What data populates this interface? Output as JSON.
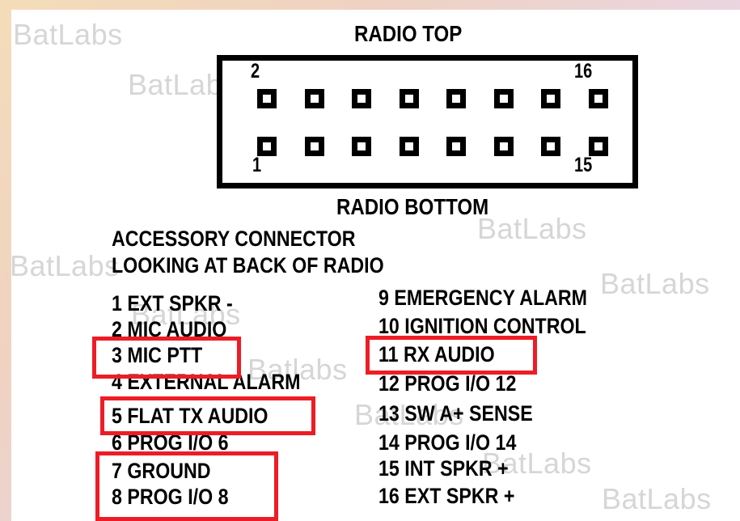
{
  "watermark_text": "BatLabs",
  "watermark_alt_text": "Batlabs",
  "radio_top_label": "RADIO TOP",
  "radio_bottom_label": "RADIO BOTTOM",
  "connector": {
    "top_row_first_pin": "2",
    "top_row_last_pin": "16",
    "bottom_row_first_pin": "1",
    "bottom_row_last_pin": "15",
    "pins_per_row": 8
  },
  "caption_line1": "ACCESSORY CONNECTOR",
  "caption_line2": "LOOKING AT BACK OF RADIO",
  "pins_left": [
    "1 EXT SPKR -",
    "2 MIC AUDIO",
    "3 MIC PTT",
    "4 EXTERNAL ALARM",
    "5 FLAT TX AUDIO",
    "6 PROG I/O 6",
    "7 GROUND",
    "8 PROG I/O 8"
  ],
  "pins_right": [
    "9 EMERGENCY ALARM",
    "10 IGNITION CONTROL",
    "11 RX AUDIO",
    "12 PROG I/O 12",
    "13 SW A+ SENSE",
    "14 PROG I/O 14",
    "15 INT SPKR +",
    "16 EXT SPKR +"
  ],
  "highlight_color": "#ee1c24",
  "highlighted_pins": [
    "3 MIC PTT",
    "11 RX AUDIO",
    "5 FLAT TX AUDIO",
    "7 GROUND",
    "8 PROG I/O 8"
  ]
}
